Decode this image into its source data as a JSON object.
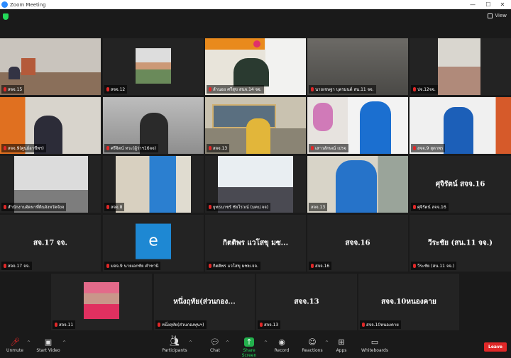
{
  "window": {
    "title": "Zoom Meeting"
  },
  "topbar": {
    "view_label": "View"
  },
  "tiles": [
    {
      "name": "สจจ.15",
      "kind": "video"
    },
    {
      "name": "สจจ.12",
      "kind": "video"
    },
    {
      "name": "ลำนอย ศรีสุข สนจ.14 จจ.",
      "kind": "video"
    },
    {
      "name": "นายเชษฐา บุตรมนต์ สน.11 จจ.",
      "kind": "video"
    },
    {
      "name": "ปจ.12จจ.",
      "kind": "video"
    },
    {
      "name": "สจจ.9(ศูนย์อาชีพฯ)",
      "kind": "video"
    },
    {
      "name": "ศรีจิตน์ ทวะ(ผู้ว่าฯ16จจ)",
      "kind": "video"
    },
    {
      "name": "สจจ.13",
      "kind": "video"
    },
    {
      "name": "เสาวลักษณ์ เปรจ",
      "kind": "video"
    },
    {
      "name": "สจจ.9 สุดาพร",
      "kind": "video"
    },
    {
      "name": "สำนักงานจัดหาที่ดินจังหวัดจังจ",
      "kind": "video"
    },
    {
      "name": "สจจ.8",
      "kind": "video"
    },
    {
      "name": "ยุทธนาชรั ชัยโรวณ์ (มคป.จจ)",
      "kind": "video"
    },
    {
      "name": "สจจ.13",
      "kind": "video",
      "active": true
    },
    {
      "name": "ศุจิรัตน์ สจจ.16",
      "kind": "name",
      "big": "ศุจิรัตน์  สจจ.16"
    },
    {
      "name": "สจจ.17 จจ.",
      "kind": "name",
      "big": "สจ.17 จจ."
    },
    {
      "name": "มจจ.9 นายเอกชัย คำชานี",
      "kind": "logo",
      "logo": "e"
    },
    {
      "name": "กิตติพร แวโสขุ มซฆ.จจ.",
      "kind": "name",
      "big": "กิตติพร แวโสขุ มซ..."
    },
    {
      "name": "สจจ.16",
      "kind": "name",
      "big": "สจจ.16"
    },
    {
      "name": "วีระชัย (สน.11 จจ.)",
      "kind": "name",
      "big": "วีระชัย (สน.11 จจ.)"
    },
    {
      "name": "สจจ.11",
      "kind": "video"
    },
    {
      "name": "หนึ่งฤทัย(ส่วนกองทุนฯ)",
      "kind": "name",
      "big": "หนึ่งฤทัย(ส่วนกอง..."
    },
    {
      "name": "สจจ.13",
      "kind": "name",
      "big": "สจจ.13"
    },
    {
      "name": "สจจ.10หนองคาย",
      "kind": "name",
      "big": "สจจ.10หนองคาย"
    }
  ],
  "toolbar": {
    "unmute": "Unmute",
    "start_video": "Start Video",
    "participants": "Participants",
    "participants_count": "24",
    "chat": "Chat",
    "share_screen": "Share Screen",
    "record": "Record",
    "reactions": "Reactions",
    "apps": "Apps",
    "whiteboards": "Whiteboards",
    "leave": "Leave"
  }
}
